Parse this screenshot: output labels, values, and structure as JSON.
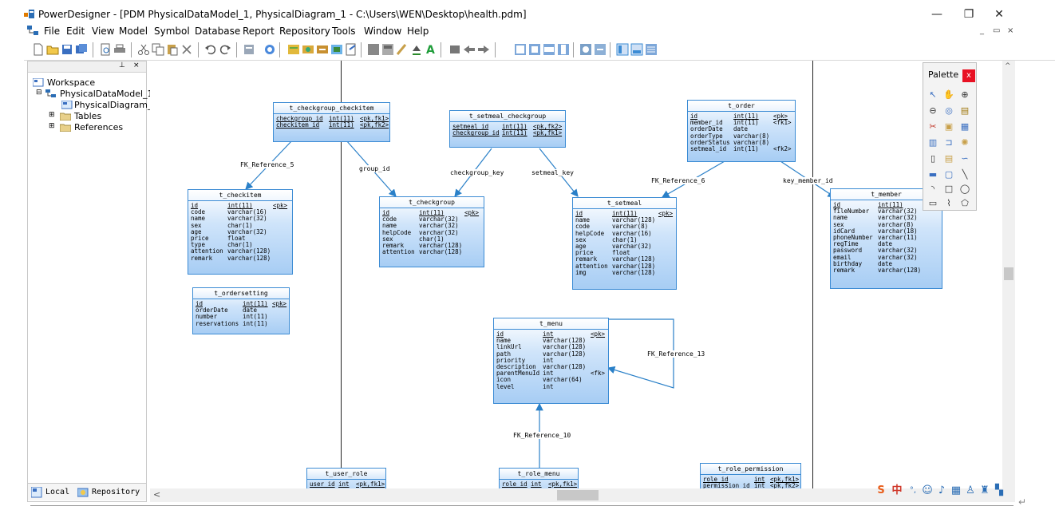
{
  "window": {
    "title": "PowerDesigner - [PDM PhysicalDataModel_1, PhysicalDiagram_1 - C:\\Users\\WEN\\Desktop\\health.pdm]",
    "minimize": "—",
    "restore": "❐",
    "close": "✕"
  },
  "menu": {
    "items": [
      "File",
      "Edit",
      "View",
      "Model",
      "Symbol",
      "Database",
      "Report",
      "Repository",
      "Tools",
      "Window",
      "Help"
    ],
    "mdi_min": "_",
    "mdi_restore": "▭",
    "mdi_close": "×"
  },
  "browser": {
    "tree": {
      "workspace": "Workspace",
      "model": "PhysicalDataModel_1",
      "diagram": "PhysicalDiagram_1",
      "tables": "Tables",
      "references": "References"
    },
    "tabs": {
      "local": "Local",
      "repository": "Repository"
    }
  },
  "palette": {
    "title": "Palette",
    "close": "x"
  },
  "ime": {
    "zhong": "中",
    "punct": "°,"
  },
  "entities": {
    "checkgroup_checkitem": {
      "name": "t_checkgroup_checkitem",
      "cols": [
        [
          "checkgroup_id",
          "int(11)",
          "<pk,fk1>"
        ],
        [
          "checkitem_id",
          "int(11)",
          "<pk,fk2>"
        ]
      ]
    },
    "setmeal_checkgroup": {
      "name": "t_setmeal_checkgroup",
      "cols": [
        [
          "setmeal_id",
          "int(11)",
          "<pk,fk2>"
        ],
        [
          "checkgroup_id",
          "int(11)",
          "<pk,fk1>"
        ]
      ]
    },
    "order": {
      "name": "t_order",
      "cols": [
        [
          "id",
          "int(11)",
          "<pk>"
        ],
        [
          "member_id",
          "int(11)",
          "<fk1>"
        ],
        [
          "orderDate",
          "date",
          ""
        ],
        [
          "orderType",
          "varchar(8)",
          ""
        ],
        [
          "orderStatus",
          "varchar(8)",
          ""
        ],
        [
          "setmeal_id",
          "int(11)",
          "<fk2>"
        ]
      ]
    },
    "checkitem": {
      "name": "t_checkitem",
      "cols": [
        [
          "id",
          "int(11)",
          "<pk>"
        ],
        [
          "code",
          "varchar(16)",
          ""
        ],
        [
          "name",
          "varchar(32)",
          ""
        ],
        [
          "sex",
          "char(1)",
          ""
        ],
        [
          "age",
          "varchar(32)",
          ""
        ],
        [
          "price",
          "float",
          ""
        ],
        [
          "type",
          "char(1)",
          ""
        ],
        [
          "attention",
          "varchar(128)",
          ""
        ],
        [
          "remark",
          "varchar(128)",
          ""
        ]
      ]
    },
    "checkgroup": {
      "name": "t_checkgroup",
      "cols": [
        [
          "id",
          "int(11)",
          "<pk>"
        ],
        [
          "code",
          "varchar(32)",
          ""
        ],
        [
          "name",
          "varchar(32)",
          ""
        ],
        [
          "helpCode",
          "varchar(32)",
          ""
        ],
        [
          "sex",
          "char(1)",
          ""
        ],
        [
          "remark",
          "varchar(128)",
          ""
        ],
        [
          "attention",
          "varchar(128)",
          ""
        ]
      ]
    },
    "setmeal": {
      "name": "t_setmeal",
      "cols": [
        [
          "id",
          "int(11)",
          "<pk>"
        ],
        [
          "name",
          "varchar(128)",
          ""
        ],
        [
          "code",
          "varchar(8)",
          ""
        ],
        [
          "helpCode",
          "varchar(16)",
          ""
        ],
        [
          "sex",
          "char(1)",
          ""
        ],
        [
          "age",
          "varchar(32)",
          ""
        ],
        [
          "price",
          "float",
          ""
        ],
        [
          "remark",
          "varchar(128)",
          ""
        ],
        [
          "attention",
          "varchar(128)",
          ""
        ],
        [
          "img",
          "varchar(128)",
          ""
        ]
      ]
    },
    "member": {
      "name": "t_member",
      "cols": [
        [
          "id",
          "int(11)",
          ""
        ],
        [
          "fileNumber",
          "varchar(32)",
          ""
        ],
        [
          "name",
          "varchar(32)",
          ""
        ],
        [
          "sex",
          "varchar(8)",
          ""
        ],
        [
          "idCard",
          "varchar(18)",
          ""
        ],
        [
          "phoneNumber",
          "varchar(11)",
          ""
        ],
        [
          "regTime",
          "date",
          ""
        ],
        [
          "password",
          "varchar(32)",
          ""
        ],
        [
          "email",
          "varchar(32)",
          ""
        ],
        [
          "birthday",
          "date",
          ""
        ],
        [
          "remark",
          "varchar(128)",
          ""
        ]
      ]
    },
    "ordersetting": {
      "name": "t_ordersetting",
      "cols": [
        [
          "id",
          "int(11)",
          "<pk>"
        ],
        [
          "orderDate",
          "date",
          ""
        ],
        [
          "number",
          "int(11)",
          ""
        ],
        [
          "reservations",
          "int(11)",
          ""
        ]
      ]
    },
    "menu": {
      "name": "t_menu",
      "cols": [
        [
          "id",
          "int",
          "<pk>"
        ],
        [
          "name",
          "varchar(128)",
          ""
        ],
        [
          "linkUrl",
          "varchar(128)",
          ""
        ],
        [
          "path",
          "varchar(128)",
          ""
        ],
        [
          "priority",
          "int",
          ""
        ],
        [
          "description",
          "varchar(128)",
          ""
        ],
        [
          "parentMenuId",
          "int",
          "<fk>"
        ],
        [
          "icon",
          "varchar(64)",
          ""
        ],
        [
          "level",
          "int",
          ""
        ]
      ]
    },
    "user_role": {
      "name": "t_user_role",
      "cols": [
        [
          "user_id",
          "int",
          "<pk,fk1>"
        ]
      ]
    },
    "role_menu": {
      "name": "t_role_menu",
      "cols": [
        [
          "role_id",
          "int",
          "<pk,fk1>"
        ]
      ]
    },
    "role_permission": {
      "name": "t_role_permission",
      "cols": [
        [
          "role_id",
          "int",
          "<pk,fk1>"
        ],
        [
          "permission_id",
          "int",
          "<pk,fk2>"
        ]
      ]
    }
  },
  "references": {
    "fk5": "FK_Reference_5",
    "group_id": "group_id",
    "checkgroup_key": "checkgroup_key",
    "setmeal_key": "setmeal_key",
    "fk6": "FK_Reference_6",
    "key_member_id": "key_member_id",
    "fk13": "FK_Reference_13",
    "fk10": "FK_Reference_10"
  }
}
